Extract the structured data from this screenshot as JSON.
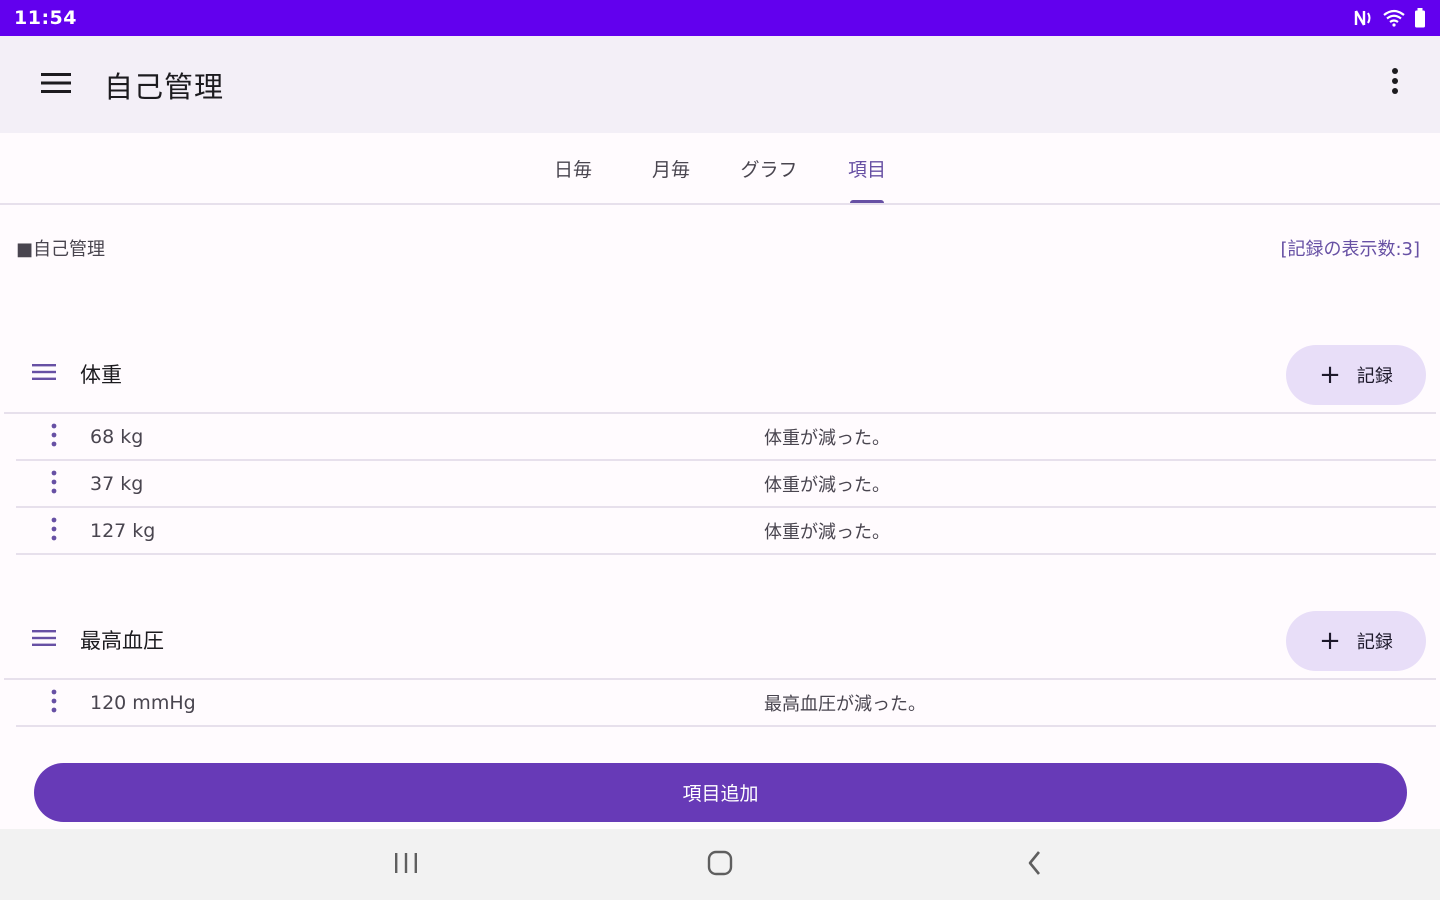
{
  "status_bar": {
    "time": "11:54"
  },
  "app_bar": {
    "title": "自己管理"
  },
  "tabs": [
    {
      "label": "日毎",
      "active": false
    },
    {
      "label": "月毎",
      "active": false
    },
    {
      "label": "グラフ",
      "active": false
    },
    {
      "label": "項目",
      "active": true
    }
  ],
  "section": {
    "title": "■自己管理",
    "record_count": "[記録の表示数:3]"
  },
  "groups": [
    {
      "name": "体重",
      "record_button": "記録",
      "entries": [
        {
          "value": "68 kg",
          "note": "体重が減った。"
        },
        {
          "value": "37 kg",
          "note": "体重が減った。"
        },
        {
          "value": "127 kg",
          "note": "体重が減った。"
        }
      ]
    },
    {
      "name": "最高血圧",
      "record_button": "記録",
      "entries": [
        {
          "value": "120 mmHg",
          "note": "最高血圧が減った。"
        }
      ]
    }
  ],
  "add_item_button": "項目追加",
  "colors": {
    "status_bar": "#6200ee",
    "accent": "#6750a4",
    "button": "#673ab7",
    "chip": "#e8def8"
  },
  "icons": {
    "menu": "hamburger-icon",
    "overflow": "more-vert-icon",
    "drag": "drag-handle-icon",
    "entry_more": "more-vert-icon",
    "plus": "plus-icon",
    "nav": [
      "recent-apps-icon",
      "home-icon",
      "back-icon"
    ]
  }
}
